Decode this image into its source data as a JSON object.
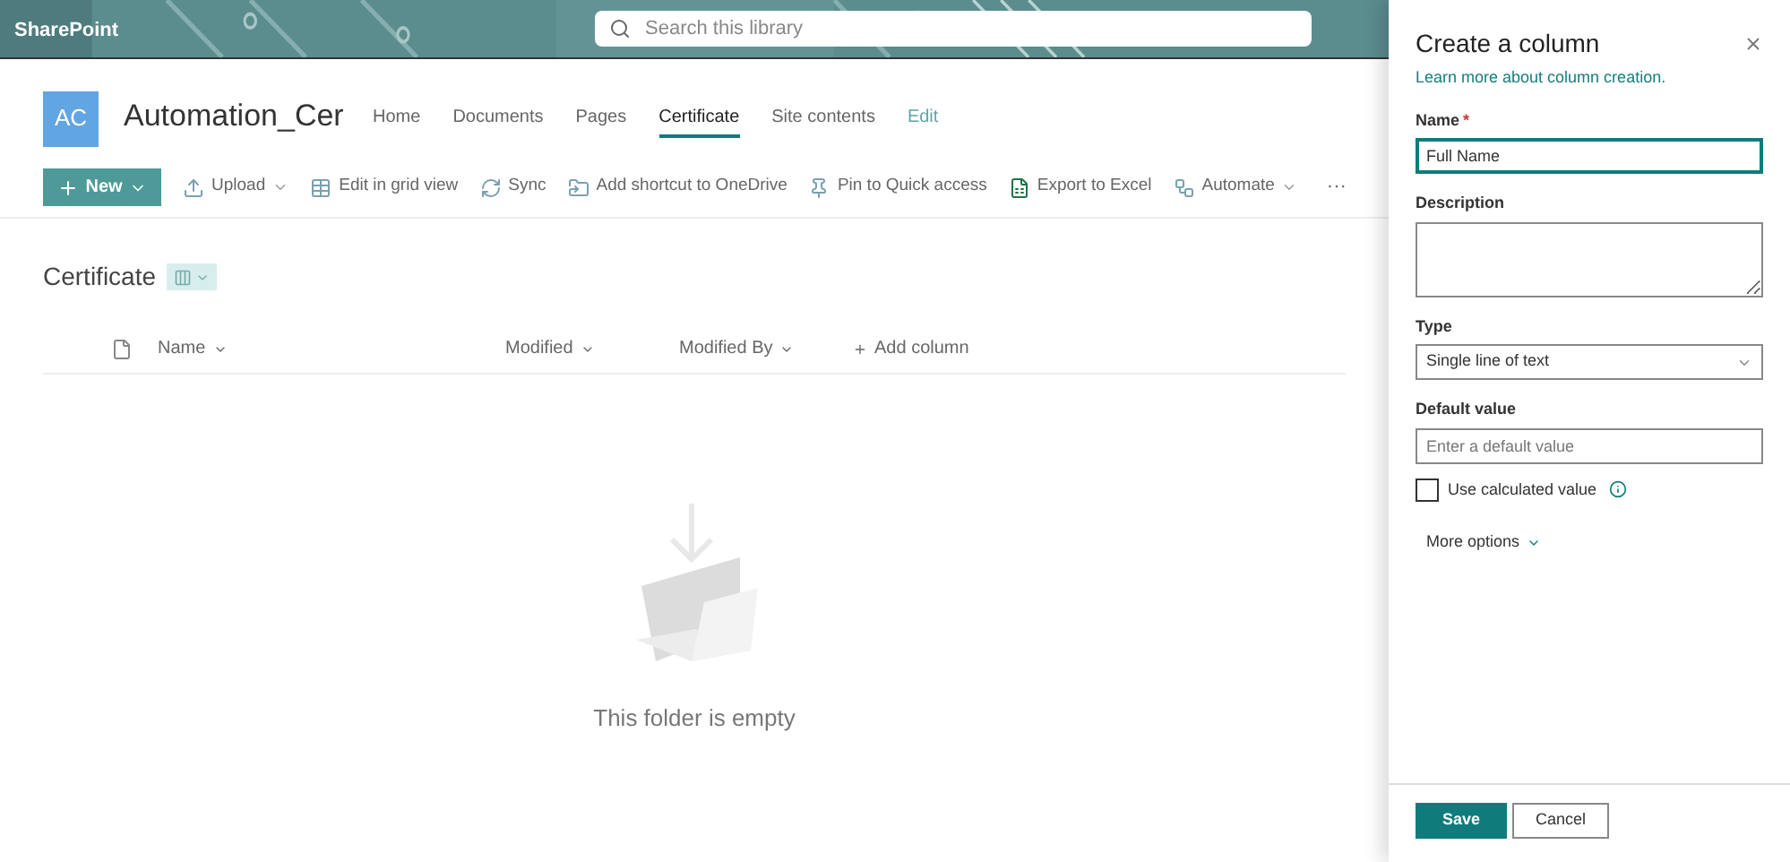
{
  "top_bar": {
    "app_name": "SharePoint",
    "search_placeholder": "Search this library"
  },
  "site": {
    "initials": "AC",
    "title": "Automation_Cer"
  },
  "nav": [
    {
      "label": "Home",
      "selected": false
    },
    {
      "label": "Documents",
      "selected": false
    },
    {
      "label": "Pages",
      "selected": false
    },
    {
      "label": "Certificate",
      "selected": true
    },
    {
      "label": "Site contents",
      "selected": false
    },
    {
      "label": "Edit",
      "selected": false,
      "kind": "link"
    }
  ],
  "toolbar": {
    "new_button": "New",
    "items": [
      {
        "label": "Upload",
        "dropdown": true
      },
      {
        "label": "Edit in grid view",
        "dropdown": false
      },
      {
        "label": "Sync",
        "dropdown": false
      },
      {
        "label": "Add shortcut to OneDrive",
        "dropdown": false
      },
      {
        "label": "Pin to Quick access",
        "dropdown": false
      },
      {
        "label": "Export to Excel",
        "dropdown": false
      },
      {
        "label": "Automate",
        "dropdown": true
      }
    ],
    "more": "···"
  },
  "library": {
    "title": "Certificate",
    "columns": [
      {
        "label": "Name"
      },
      {
        "label": "Modified"
      },
      {
        "label": "Modified By"
      }
    ],
    "add_column": "Add column",
    "empty_message": "This folder is empty"
  },
  "panel": {
    "title": "Create a column",
    "learn_link": "Learn more about column creation.",
    "name_label": "Name",
    "required_mark": "*",
    "name_value": "Full Name",
    "description_label": "Description",
    "type_label": "Type",
    "type_value": "Single line of text",
    "default_label": "Default value",
    "default_placeholder": "Enter a default value",
    "calculated": {
      "label": "Use calculated value",
      "checked": false
    },
    "more_options": "More options",
    "buttons": [
      {
        "label": "Save",
        "kind": "primary"
      },
      {
        "label": "Cancel",
        "kind": "secondary"
      }
    ]
  }
}
